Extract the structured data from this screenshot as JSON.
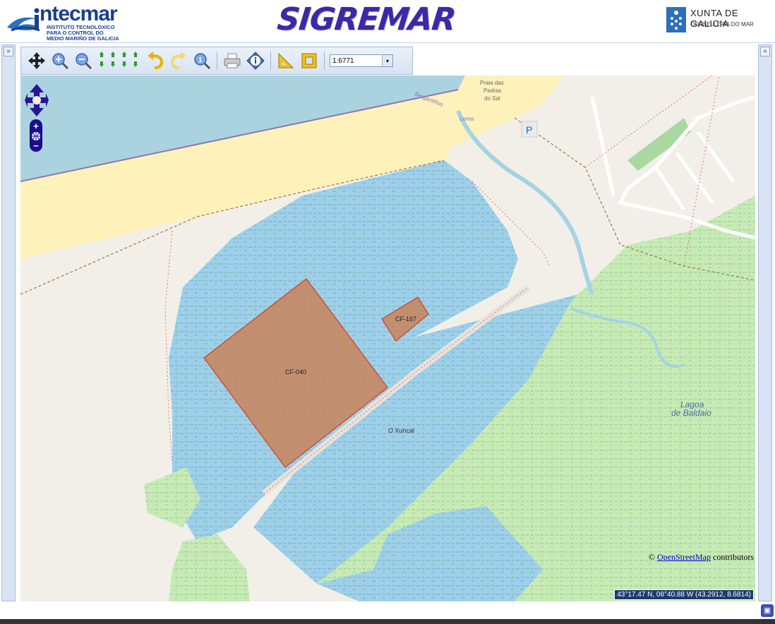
{
  "header": {
    "intecmar_word": "ntecmar",
    "intecmar_sub1": "INSTITUTO TECNOLOXICO",
    "intecmar_sub2": "PARA O CONTROL DO",
    "intecmar_sub3": "MEDIO MARIÑO DE GALICIA",
    "app_title": "SIGREMAR",
    "xunta_title": "XUNTA DE GALICIA",
    "xunta_subtitle": "CONSELLERÍA DO MAR"
  },
  "sidebars": {
    "left_toggle": "»",
    "right_toggle": "«"
  },
  "toolbar": {
    "tools": [
      "pan-icon",
      "zoom-in-icon",
      "zoom-out-icon",
      "pan-arrows-icon",
      "undo-icon",
      "redo-icon",
      "zoom-extent-icon",
      "print-icon",
      "info-icon",
      "measure-icon",
      "area-icon"
    ],
    "scale_value": "1:6771",
    "scale_arrow": "▾"
  },
  "map": {
    "labels": {
      "bergantinos": "Bergantiños",
      "praia1": "Praia das",
      "praia2": "Pedras",
      "praia3": "do Sal",
      "lema": "Lema",
      "parking": "P",
      "lagoa1": "Lagoa",
      "lagoa2": "de Baldaio",
      "xuncal": "O Xuncal"
    },
    "parcels": [
      "CF-040",
      "CF-167"
    ],
    "attribution_symbol": "©",
    "attribution_link": "OpenStreetMap",
    "attribution_text": " contributors",
    "coordinates": "43°17.47 N, 08°40.88 W (43.2912, 8.6814)",
    "colors": {
      "sea": "#aad3df",
      "beach": "#fff1ba",
      "wetland": "#8fc8e8",
      "grass": "#c7ebb0",
      "land": "#f2efe9",
      "parcel_fill": "#c8845a",
      "parcel_stroke": "#d83c1c"
    }
  },
  "footer": {
    "corner_button": "▣"
  }
}
